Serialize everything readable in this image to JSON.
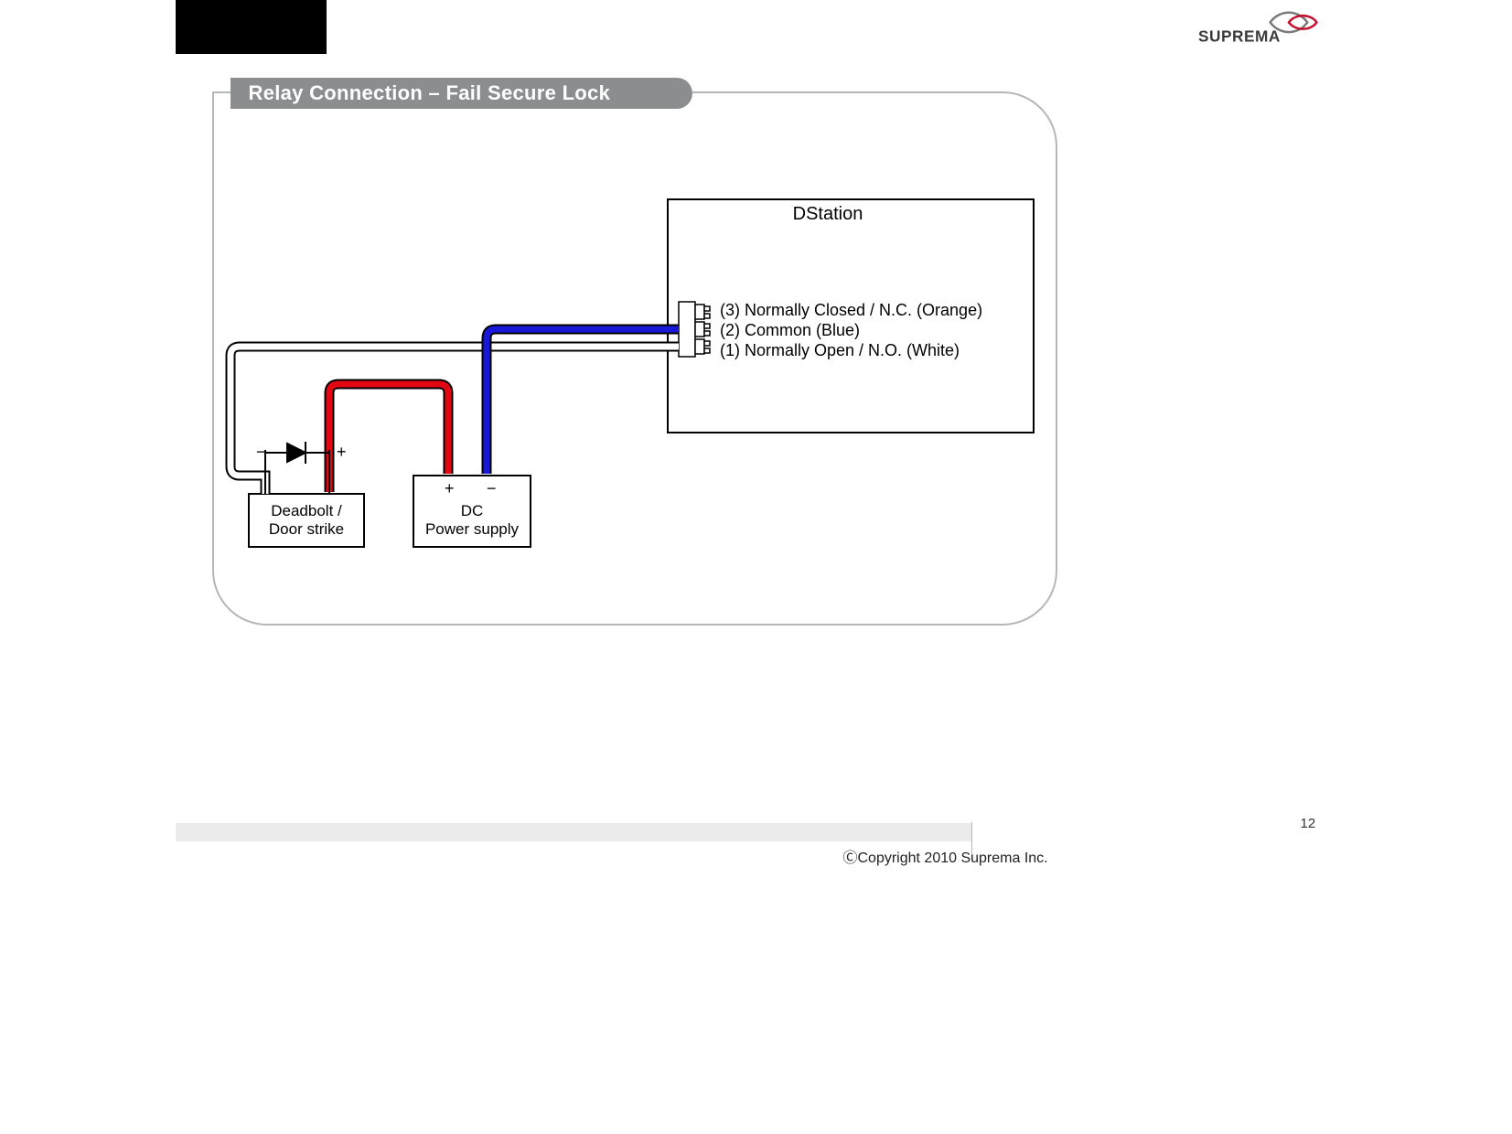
{
  "brand": "SUPREMA",
  "title": "Relay Connection – Fail Secure Lock",
  "device_label": "DStation",
  "relay_pins": [
    "(3) Normally Closed / N.C. (Orange)",
    "(2) Common (Blue)",
    "(1) Normally Open / N.O. (White)"
  ],
  "deadbolt": {
    "line1": "Deadbolt /",
    "line2": "Door strike",
    "neg": "−",
    "pos": "+"
  },
  "psu": {
    "line1": "DC",
    "line2": "Power supply",
    "pos": "+",
    "neg": "−"
  },
  "wire_colors": {
    "common": "#1818d8",
    "positive": "#e30613"
  },
  "copyright": "ⒸCopyright 2010 Suprema Inc.",
  "page": "12"
}
